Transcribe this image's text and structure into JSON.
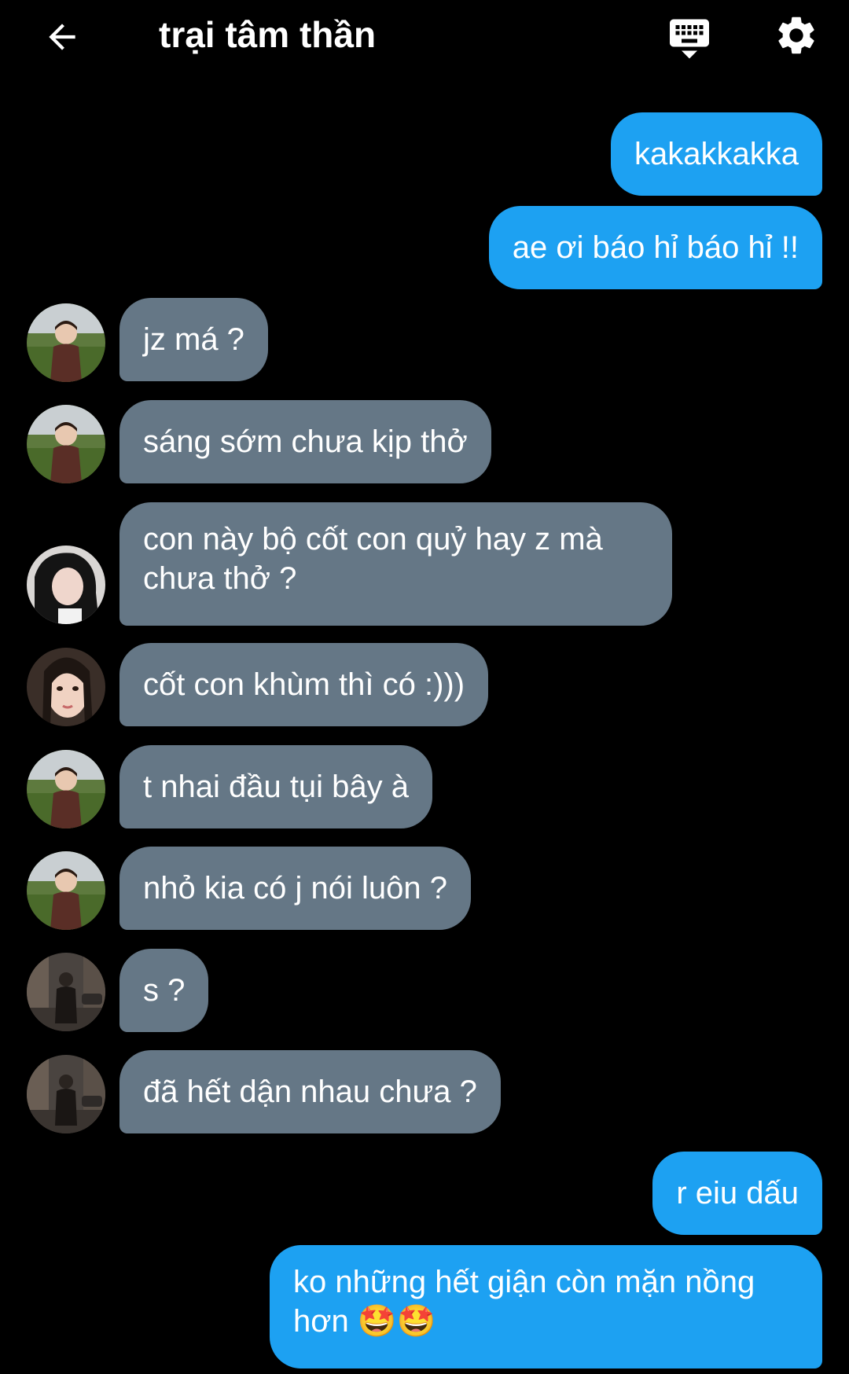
{
  "header": {
    "title": "trại tâm thần"
  },
  "messages": [
    {
      "direction": "out",
      "text": "kakakkakka"
    },
    {
      "direction": "out",
      "text": "ae ơi báo hỉ báo hỉ !!"
    },
    {
      "direction": "in",
      "avatar": "child-avatar",
      "text": "jz má ?"
    },
    {
      "direction": "in",
      "avatar": "child-avatar",
      "text": "sáng sớm chưa kịp thở"
    },
    {
      "direction": "in",
      "avatar": "dark-hair-girl-avatar",
      "text": "con này bộ cốt con quỷ hay z mà chưa thở ?"
    },
    {
      "direction": "in",
      "avatar": "selfie-girl-avatar",
      "text": "cốt con khùm thì có :)))"
    },
    {
      "direction": "in",
      "avatar": "child-avatar",
      "text": "t nhai đầu tụi bây à"
    },
    {
      "direction": "in",
      "avatar": "child-avatar",
      "text": "nhỏ kia có j nói luôn ?"
    },
    {
      "direction": "in",
      "avatar": "street-photo-avatar",
      "text": "s ?"
    },
    {
      "direction": "in",
      "avatar": "street-photo-avatar",
      "text": "đã hết dận nhau chưa ?"
    },
    {
      "direction": "out",
      "text": "r eiu dấu"
    },
    {
      "direction": "out",
      "text": "ko những hết giận còn mặn nồng hơn 🤩🤩"
    }
  ],
  "colors": {
    "background": "#000000",
    "outgoing_bubble": "#1da1f2",
    "incoming_bubble": "#657786",
    "text": "#ffffff"
  }
}
